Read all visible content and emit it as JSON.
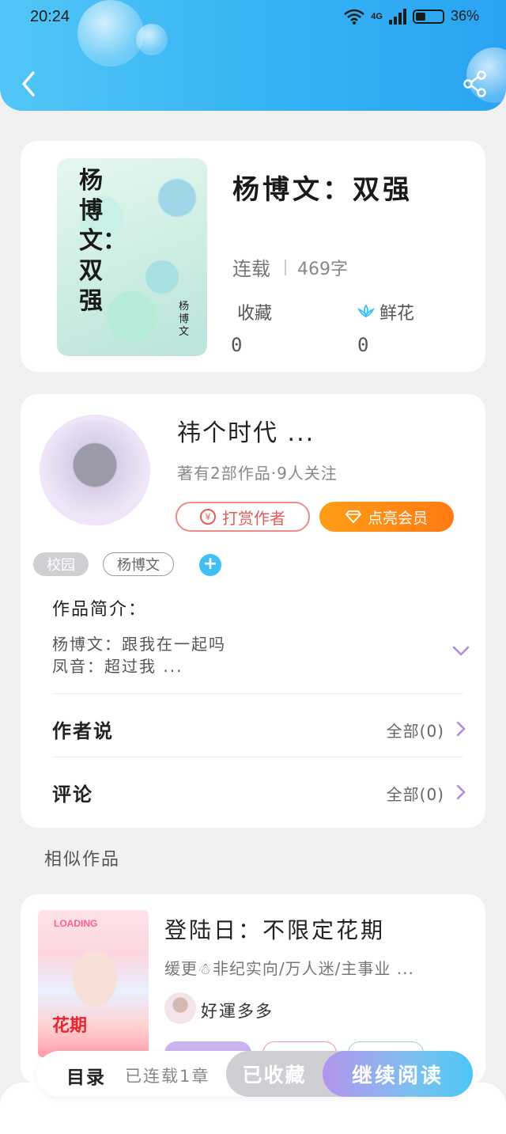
{
  "status_bar": {
    "time": "20:24",
    "network": "4G",
    "battery": "36%"
  },
  "header": {
    "back_icon": "chevron-left-icon",
    "share_icon": "share-icon"
  },
  "book": {
    "cover_title": "杨博文：双强",
    "cover_author": "杨博文",
    "title": "杨博文：双强",
    "status": "连载",
    "word_count": "469字",
    "favorites_label": "收藏",
    "favorites_value": "0",
    "flowers_label": "鲜花",
    "flowers_value": "0",
    "flower_icon": "lotus-icon"
  },
  "author": {
    "name": "祎个时代 ...",
    "meta": "著有2部作品·9人关注",
    "reward_label": "打赏作者",
    "reward_icon_text": "¥",
    "vip_label": "点亮会员",
    "tags": [
      "校园",
      "杨博文"
    ],
    "add_tag": "+",
    "intro_heading": "作品简介：",
    "intro_text": "杨博文：跟我在一起吗\n凤音：超过我 ...",
    "author_says_label": "作者说",
    "author_says_all": "全部(0)",
    "comments_label": "评论",
    "comments_all": "全部(0)"
  },
  "similar": {
    "section_title": "相似作品",
    "items": [
      {
        "title": "登陆日：不限定花期",
        "desc": "缓更☃非纪实向/万人迷/主事业 ...",
        "author": "好運多多",
        "cover_badge": "LOADING",
        "cover_script": "花期"
      }
    ]
  },
  "bottom_bar": {
    "catalog_label": "目录",
    "catalog_sub": "已连载1章",
    "collected_label": "已收藏",
    "read_label": "继续阅读"
  },
  "colors": {
    "header_blue": "#35b2f4",
    "vip_orange": "#ff8a14",
    "reward_red": "#e55b5b",
    "accent_purple": "#b08ae0"
  }
}
